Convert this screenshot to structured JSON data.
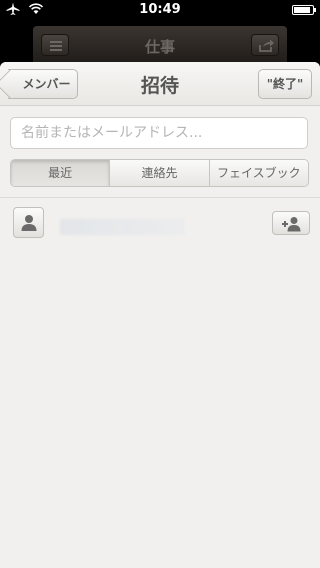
{
  "status_bar": {
    "time": "10:49",
    "battery_level": 0.9
  },
  "background_nav": {
    "title": "仕事"
  },
  "nav": {
    "title": "招待",
    "back_label": "メンバー",
    "done_label": "\"終了\""
  },
  "search": {
    "placeholder": "名前またはメールアドレス..."
  },
  "segments": [
    {
      "label": "最近",
      "active": true
    },
    {
      "label": "連絡先",
      "active": false
    },
    {
      "label": "フェイスブック",
      "active": false
    }
  ],
  "icons": {
    "avatar": "person-icon",
    "add": "add-person-icon",
    "back_menu": "menu-icon",
    "back_share": "share-icon"
  }
}
